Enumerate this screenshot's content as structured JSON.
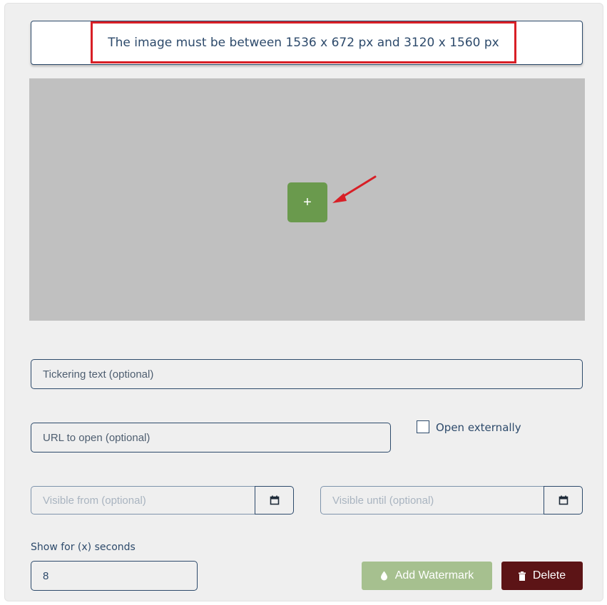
{
  "notice": {
    "text": "The image must be between 1536 x 672 px and 3120 x 1560 px"
  },
  "image_upload": {
    "add_button_label": "+",
    "add_button_icon": "plus-icon",
    "annotation_color": "#d81f26"
  },
  "form": {
    "ticker_placeholder": "Tickering text (optional)",
    "url_placeholder": "URL to open (optional)",
    "open_externally_label": "Open externally",
    "open_externally_checked": false,
    "visible_from_placeholder": "Visible from (optional)",
    "visible_until_placeholder": "Visible until (optional)",
    "calendar_icon": "calendar-icon",
    "show_for_label": "Show for (x) seconds",
    "show_for_value": "8"
  },
  "actions": {
    "watermark_label": "Add Watermark",
    "watermark_icon": "droplet-icon",
    "delete_label": "Delete",
    "delete_icon": "trash-icon"
  },
  "colors": {
    "primary": "#2d4a6b",
    "add_green": "#6a9a4d",
    "watermark_green": "#a6c08f",
    "delete_red": "#5c1416",
    "drop_zone_gray": "#c0c0c0"
  }
}
